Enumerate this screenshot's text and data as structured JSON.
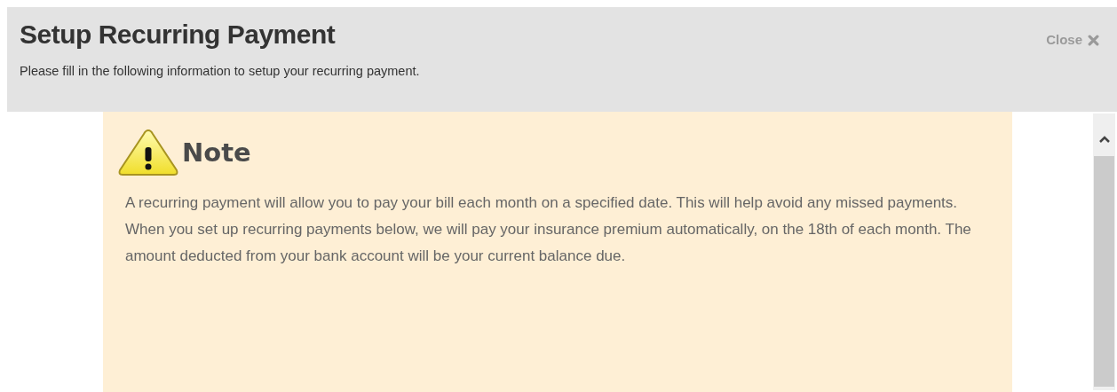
{
  "dialog": {
    "title": "Setup Recurring Payment",
    "subtitle": "Please fill in the following information to setup your recurring payment.",
    "close": "Close"
  },
  "note": {
    "heading": "Note",
    "paragraphs": [
      "A recurring payment will allow you to pay your bill each month on a specified date. This will help avoid any missed payments.",
      "When you set up recurring payments below, we will pay your insurance premium automatically, on the 18th of each month. The amount deducted from your bank account will be your current balance due."
    ]
  }
}
